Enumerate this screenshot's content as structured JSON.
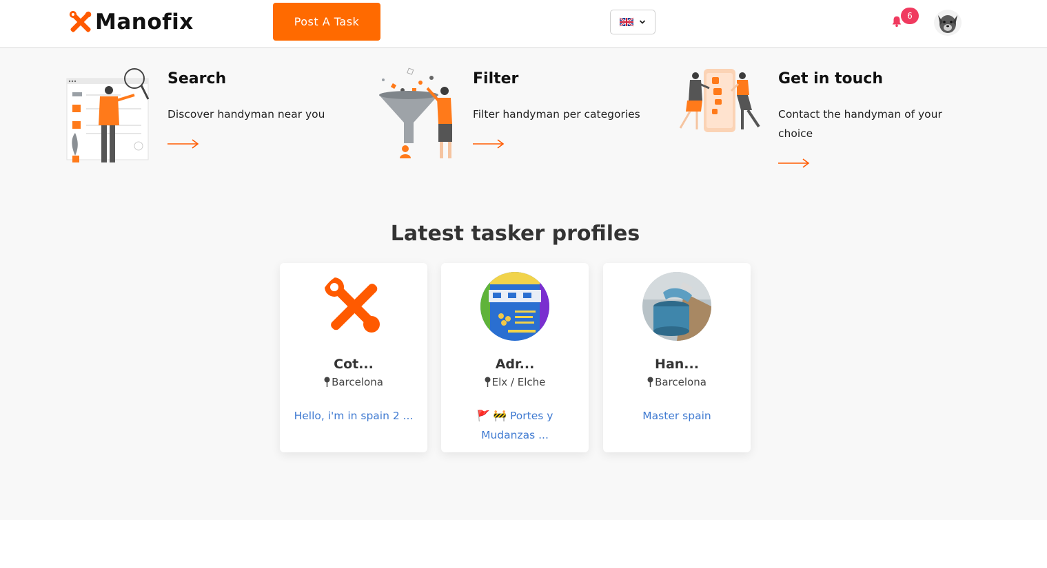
{
  "header": {
    "logo_text": "Manofix",
    "post_task_label": "Post A Task",
    "language_flag": "uk-flag-icon",
    "notification_count": "6"
  },
  "features": [
    {
      "title": "Search",
      "description": "Discover handyman near you",
      "icon": "search-illustration"
    },
    {
      "title": "Filter",
      "description": "Filter handyman per categories",
      "icon": "filter-illustration"
    },
    {
      "title": "Get in touch",
      "description": "Contact the handyman of your choice",
      "icon": "contact-illustration"
    }
  ],
  "latest": {
    "title": "Latest tasker profiles",
    "profiles": [
      {
        "name": "Cot...",
        "location": "Barcelona",
        "description": "Hello, i'm in spain 2 ..."
      },
      {
        "name": "Adr...",
        "location": "Elx / Elche",
        "description": "🚩 🚧 Portes y Mudanzas ..."
      },
      {
        "name": "Han...",
        "location": "Barcelona",
        "description": "Master spain"
      }
    ]
  },
  "colors": {
    "accent": "#ff6a00",
    "badge": "#f03a5f",
    "link": "#3f7ad1",
    "background": "#f8f8f8"
  }
}
